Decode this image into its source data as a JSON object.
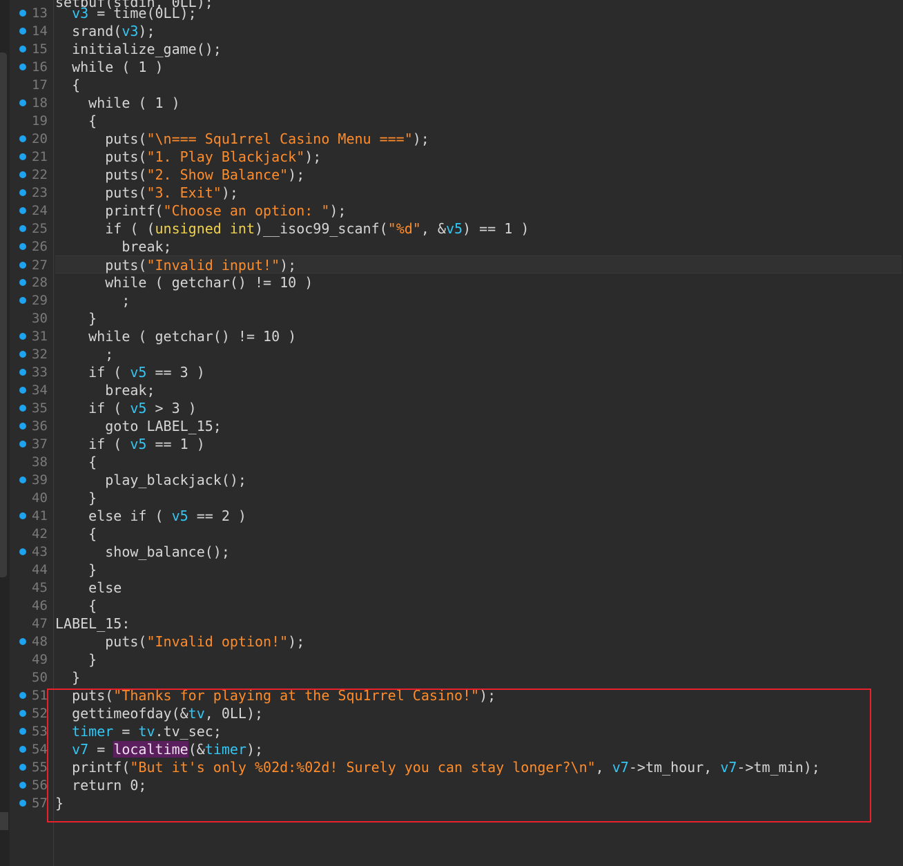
{
  "editor": {
    "partial_top_line": "setbuf(stdin, 0LL);",
    "lines": [
      {
        "no": "13",
        "bp": true,
        "tokens": [
          [
            "plain",
            "  "
          ],
          [
            "var",
            "v3"
          ],
          [
            "plain",
            " = time("
          ],
          [
            "plain",
            "0LL);"
          ]
        ]
      },
      {
        "no": "14",
        "bp": true,
        "tokens": [
          [
            "plain",
            "  srand("
          ],
          [
            "var",
            "v3"
          ],
          [
            "plain",
            ");"
          ]
        ]
      },
      {
        "no": "15",
        "bp": true,
        "tokens": [
          [
            "plain",
            "  initialize_game();"
          ]
        ]
      },
      {
        "no": "16",
        "bp": true,
        "tokens": [
          [
            "plain",
            "  while ( 1 )"
          ]
        ]
      },
      {
        "no": "17",
        "bp": false,
        "tokens": [
          [
            "plain",
            "  {"
          ]
        ]
      },
      {
        "no": "18",
        "bp": true,
        "tokens": [
          [
            "plain",
            "    while ( 1 )"
          ]
        ]
      },
      {
        "no": "19",
        "bp": false,
        "tokens": [
          [
            "plain",
            "    {"
          ]
        ]
      },
      {
        "no": "20",
        "bp": true,
        "tokens": [
          [
            "plain",
            "      puts("
          ],
          [
            "str",
            "\"\\n=== Squ1rrel Casino Menu ===\""
          ],
          [
            "plain",
            ");"
          ]
        ]
      },
      {
        "no": "21",
        "bp": true,
        "tokens": [
          [
            "plain",
            "      puts("
          ],
          [
            "str",
            "\"1. Play Blackjack\""
          ],
          [
            "plain",
            ");"
          ]
        ]
      },
      {
        "no": "22",
        "bp": true,
        "tokens": [
          [
            "plain",
            "      puts("
          ],
          [
            "str",
            "\"2. Show Balance\""
          ],
          [
            "plain",
            ");"
          ]
        ]
      },
      {
        "no": "23",
        "bp": true,
        "tokens": [
          [
            "plain",
            "      puts("
          ],
          [
            "str",
            "\"3. Exit\""
          ],
          [
            "plain",
            ");"
          ]
        ]
      },
      {
        "no": "24",
        "bp": true,
        "tokens": [
          [
            "plain",
            "      printf("
          ],
          [
            "str",
            "\"Choose an option: \""
          ],
          [
            "plain",
            ");"
          ]
        ]
      },
      {
        "no": "25",
        "bp": true,
        "tokens": [
          [
            "plain",
            "      if ( ("
          ],
          [
            "type",
            "unsigned int"
          ],
          [
            "plain",
            ")__isoc99_scanf("
          ],
          [
            "str",
            "\"%d\""
          ],
          [
            "plain",
            ", &"
          ],
          [
            "var",
            "v5"
          ],
          [
            "plain",
            ") == 1 )"
          ]
        ]
      },
      {
        "no": "26",
        "bp": true,
        "tokens": [
          [
            "plain",
            "        break;"
          ]
        ]
      },
      {
        "no": "27",
        "bp": true,
        "current": true,
        "tokens": [
          [
            "plain",
            "      puts("
          ],
          [
            "str",
            "\"Invalid input!\""
          ],
          [
            "plain",
            ");"
          ]
        ]
      },
      {
        "no": "28",
        "bp": true,
        "tokens": [
          [
            "plain",
            "      while ( getchar() != 10 )"
          ]
        ]
      },
      {
        "no": "29",
        "bp": true,
        "tokens": [
          [
            "plain",
            "        ;"
          ]
        ]
      },
      {
        "no": "30",
        "bp": false,
        "tokens": [
          [
            "plain",
            "    }"
          ]
        ]
      },
      {
        "no": "31",
        "bp": true,
        "tokens": [
          [
            "plain",
            "    while ( getchar() != 10 )"
          ]
        ]
      },
      {
        "no": "32",
        "bp": true,
        "tokens": [
          [
            "plain",
            "      ;"
          ]
        ]
      },
      {
        "no": "33",
        "bp": true,
        "tokens": [
          [
            "plain",
            "    if ( "
          ],
          [
            "var",
            "v5"
          ],
          [
            "plain",
            " == 3 )"
          ]
        ]
      },
      {
        "no": "34",
        "bp": true,
        "tokens": [
          [
            "plain",
            "      break;"
          ]
        ]
      },
      {
        "no": "35",
        "bp": true,
        "tokens": [
          [
            "plain",
            "    if ( "
          ],
          [
            "var",
            "v5"
          ],
          [
            "plain",
            " > 3 )"
          ]
        ]
      },
      {
        "no": "36",
        "bp": true,
        "tokens": [
          [
            "plain",
            "      goto LABEL_15;"
          ]
        ]
      },
      {
        "no": "37",
        "bp": true,
        "tokens": [
          [
            "plain",
            "    if ( "
          ],
          [
            "var",
            "v5"
          ],
          [
            "plain",
            " == 1 )"
          ]
        ]
      },
      {
        "no": "38",
        "bp": false,
        "tokens": [
          [
            "plain",
            "    {"
          ]
        ]
      },
      {
        "no": "39",
        "bp": true,
        "tokens": [
          [
            "plain",
            "      play_blackjack();"
          ]
        ]
      },
      {
        "no": "40",
        "bp": false,
        "tokens": [
          [
            "plain",
            "    }"
          ]
        ]
      },
      {
        "no": "41",
        "bp": true,
        "tokens": [
          [
            "plain",
            "    else if ( "
          ],
          [
            "var",
            "v5"
          ],
          [
            "plain",
            " == 2 )"
          ]
        ]
      },
      {
        "no": "42",
        "bp": false,
        "tokens": [
          [
            "plain",
            "    {"
          ]
        ]
      },
      {
        "no": "43",
        "bp": true,
        "tokens": [
          [
            "plain",
            "      show_balance();"
          ]
        ]
      },
      {
        "no": "44",
        "bp": false,
        "tokens": [
          [
            "plain",
            "    }"
          ]
        ]
      },
      {
        "no": "45",
        "bp": false,
        "tokens": [
          [
            "plain",
            "    else"
          ]
        ]
      },
      {
        "no": "46",
        "bp": false,
        "tokens": [
          [
            "plain",
            "    {"
          ]
        ]
      },
      {
        "no": "47",
        "bp": false,
        "tokens": [
          [
            "plain",
            "LABEL_15:"
          ]
        ]
      },
      {
        "no": "48",
        "bp": true,
        "tokens": [
          [
            "plain",
            "      puts("
          ],
          [
            "str",
            "\"Invalid option!\""
          ],
          [
            "plain",
            ");"
          ]
        ]
      },
      {
        "no": "49",
        "bp": false,
        "tokens": [
          [
            "plain",
            "    }"
          ]
        ]
      },
      {
        "no": "50",
        "bp": false,
        "tokens": [
          [
            "plain",
            "  }"
          ]
        ]
      },
      {
        "no": "51",
        "bp": true,
        "tokens": [
          [
            "plain",
            "  puts("
          ],
          [
            "str",
            "\"Thanks for playing at the Squ1rrel Casino!\""
          ],
          [
            "plain",
            ");"
          ]
        ]
      },
      {
        "no": "52",
        "bp": true,
        "tokens": [
          [
            "plain",
            "  gettimeofday(&"
          ],
          [
            "var",
            "tv"
          ],
          [
            "plain",
            ", 0LL);"
          ]
        ]
      },
      {
        "no": "53",
        "bp": true,
        "tokens": [
          [
            "plain",
            "  "
          ],
          [
            "var",
            "timer"
          ],
          [
            "plain",
            " = "
          ],
          [
            "var",
            "tv"
          ],
          [
            "plain",
            ".tv_sec;"
          ]
        ]
      },
      {
        "no": "54",
        "bp": true,
        "tokens": [
          [
            "plain",
            "  "
          ],
          [
            "var",
            "v7"
          ],
          [
            "plain",
            " = "
          ],
          [
            "hl",
            "localtime"
          ],
          [
            "plain",
            "(&"
          ],
          [
            "var",
            "timer"
          ],
          [
            "plain",
            ");"
          ]
        ]
      },
      {
        "no": "55",
        "bp": true,
        "tokens": [
          [
            "plain",
            "  printf("
          ],
          [
            "str",
            "\"But it's only %02d:%02d! Surely you can stay longer?\\n\""
          ],
          [
            "plain",
            ", "
          ],
          [
            "var",
            "v7"
          ],
          [
            "plain",
            "->tm_hour, "
          ],
          [
            "var",
            "v7"
          ],
          [
            "plain",
            "->tm_min);"
          ]
        ]
      },
      {
        "no": "56",
        "bp": true,
        "tokens": [
          [
            "plain",
            "  return 0;"
          ]
        ]
      },
      {
        "no": "57",
        "bp": true,
        "tokens": [
          [
            "plain",
            "}"
          ]
        ]
      }
    ]
  },
  "colors": {
    "background": "#2b2b2b",
    "breakpoint_dot": "#1ea3f0",
    "string": "#ff8c2a",
    "variable": "#33c7f5",
    "type": "#f0d24a",
    "highlight_bg": "#5a1f5c",
    "selection_box": "#e8212d"
  }
}
